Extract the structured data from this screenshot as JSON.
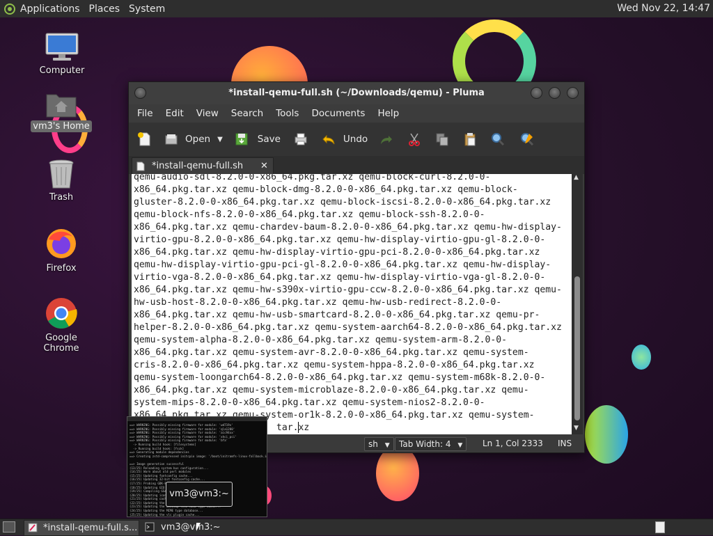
{
  "top_panel": {
    "menus": [
      "Applications",
      "Places",
      "System"
    ],
    "clock": "Wed Nov 22, 14:47"
  },
  "desktop_icons": [
    {
      "label": "Computer",
      "icon": "computer-icon"
    },
    {
      "label": "vm3's Home",
      "icon": "home-folder-icon"
    },
    {
      "label": "Trash",
      "icon": "trash-icon"
    },
    {
      "label": "Firefox",
      "icon": "firefox-icon"
    },
    {
      "label": "Google Chrome",
      "icon": "chrome-icon"
    }
  ],
  "window": {
    "title": "*install-qemu-full.sh (~/Downloads/qemu) - Pluma",
    "menu": [
      "File",
      "Edit",
      "View",
      "Search",
      "Tools",
      "Documents",
      "Help"
    ],
    "toolbar": {
      "open": "Open",
      "save": "Save",
      "undo": "Undo"
    },
    "tab_label": "*install-qemu-full.sh",
    "editor_lines": [
      "qemu-audio-sdl-8.2.0-0-x86_64.pkg.tar.xz qemu-block-curl-8.2.0-0-",
      "x86_64.pkg.tar.xz qemu-block-dmg-8.2.0-0-x86_64.pkg.tar.xz qemu-block-",
      "gluster-8.2.0-0-x86_64.pkg.tar.xz qemu-block-iscsi-8.2.0-0-x86_64.pkg.tar.xz",
      "qemu-block-nfs-8.2.0-0-x86_64.pkg.tar.xz qemu-block-ssh-8.2.0-0-",
      "x86_64.pkg.tar.xz qemu-chardev-baum-8.2.0-0-x86_64.pkg.tar.xz qemu-hw-display-",
      "virtio-gpu-8.2.0-0-x86_64.pkg.tar.xz qemu-hw-display-virtio-gpu-gl-8.2.0-0-",
      "x86_64.pkg.tar.xz qemu-hw-display-virtio-gpu-pci-8.2.0-0-x86_64.pkg.tar.xz",
      "qemu-hw-display-virtio-gpu-pci-gl-8.2.0-0-x86_64.pkg.tar.xz qemu-hw-display-",
      "virtio-vga-8.2.0-0-x86_64.pkg.tar.xz qemu-hw-display-virtio-vga-gl-8.2.0-0-",
      "x86_64.pkg.tar.xz qemu-hw-s390x-virtio-gpu-ccw-8.2.0-0-x86_64.pkg.tar.xz qemu-",
      "hw-usb-host-8.2.0-0-x86_64.pkg.tar.xz qemu-hw-usb-redirect-8.2.0-0-",
      "x86_64.pkg.tar.xz qemu-hw-usb-smartcard-8.2.0-0-x86_64.pkg.tar.xz qemu-pr-",
      "helper-8.2.0-0-x86_64.pkg.tar.xz qemu-system-aarch64-8.2.0-0-x86_64.pkg.tar.xz",
      "qemu-system-alpha-8.2.0-0-x86_64.pkg.tar.xz qemu-system-arm-8.2.0-0-",
      "x86_64.pkg.tar.xz qemu-system-avr-8.2.0-0-x86_64.pkg.tar.xz qemu-system-",
      "cris-8.2.0-0-x86_64.pkg.tar.xz qemu-system-hppa-8.2.0-0-x86_64.pkg.tar.xz",
      "qemu-system-loongarch64-8.2.0-0-x86_64.pkg.tar.xz qemu-system-m68k-8.2.0-0-",
      "x86_64.pkg.tar.xz qemu-system-microblaze-8.2.0-0-x86_64.pkg.tar.xz qemu-",
      "system-mips-8.2.0-0-x86_64.pkg.tar.xz qemu-system-nios2-8.2.0-0-",
      "x86_64.pkg.tar.xz qemu-system-or1k-8.2.0-0-x86_64.pkg.tar.xz qemu-system-",
      "                          tar.xz"
    ],
    "status": {
      "language": "sh",
      "tab_width": "Tab Width:  4",
      "position": "Ln 1, Col 2333",
      "mode": "INS"
    }
  },
  "terminal_preview": {
    "lines": [
      "==> WARNING: Possibly missing firmware for module: 'wd719x'",
      "==> WARNING: Possibly missing firmware for module: 'qla1280'",
      "==> WARNING: Possibly missing firmware for module: 'aic94xx'",
      "==> WARNING: Possibly missing firmware for module: 'xhci_pci'",
      "==> WARNING: Possibly missing firmware for module: 'bfa'",
      "  -> Running build hook: [filesystems]",
      "  -> Running build hook: [fsck]",
      "==> Generating module dependencies",
      "==> Creating zstd-compressed initcpio image: '/boot/initramfs-linux-fallback.img'",
      "",
      "==> Image generation successful",
      "(13/25) Reloading system bus configuration...",
      "(14/25) Warn about old perl modules",
      "(15/25) Updating fontconfig cache...",
      "(16/25) Updating 32-bit fontconfig cache...",
      "(17/25) Probing GDK-Pixbuf loader modules...",
      "(18/25) Updating GIO module cache...",
      "(19/25) Compiling GSettings XML schema files...",
      "(20/25) Updating icon theme caches...",
      "(21/25) Updating cache...",
      "(22/25) Updating the info directory file...",
      "(23/25) Updating the desktop file MIME type cache...",
      "(24/25) Updating the MIME type database...",
      "(25/25) Updating the vlc plugin cache...",
      "[vm3@vm3 ~]$ "
    ],
    "tooltip": "vm3@vm3:~"
  },
  "bottom_panel": {
    "tasks": [
      {
        "label": "*install-qemu-full.s...",
        "icon": "text-editor-icon"
      },
      {
        "label": "vm3@vm3:~",
        "icon": "terminal-icon"
      }
    ]
  },
  "colors": {
    "panel": "#2e2e2e",
    "window_bg": "#3c3c3c",
    "editor_bg": "#ffffff",
    "desktop": "#2a0f2e"
  }
}
